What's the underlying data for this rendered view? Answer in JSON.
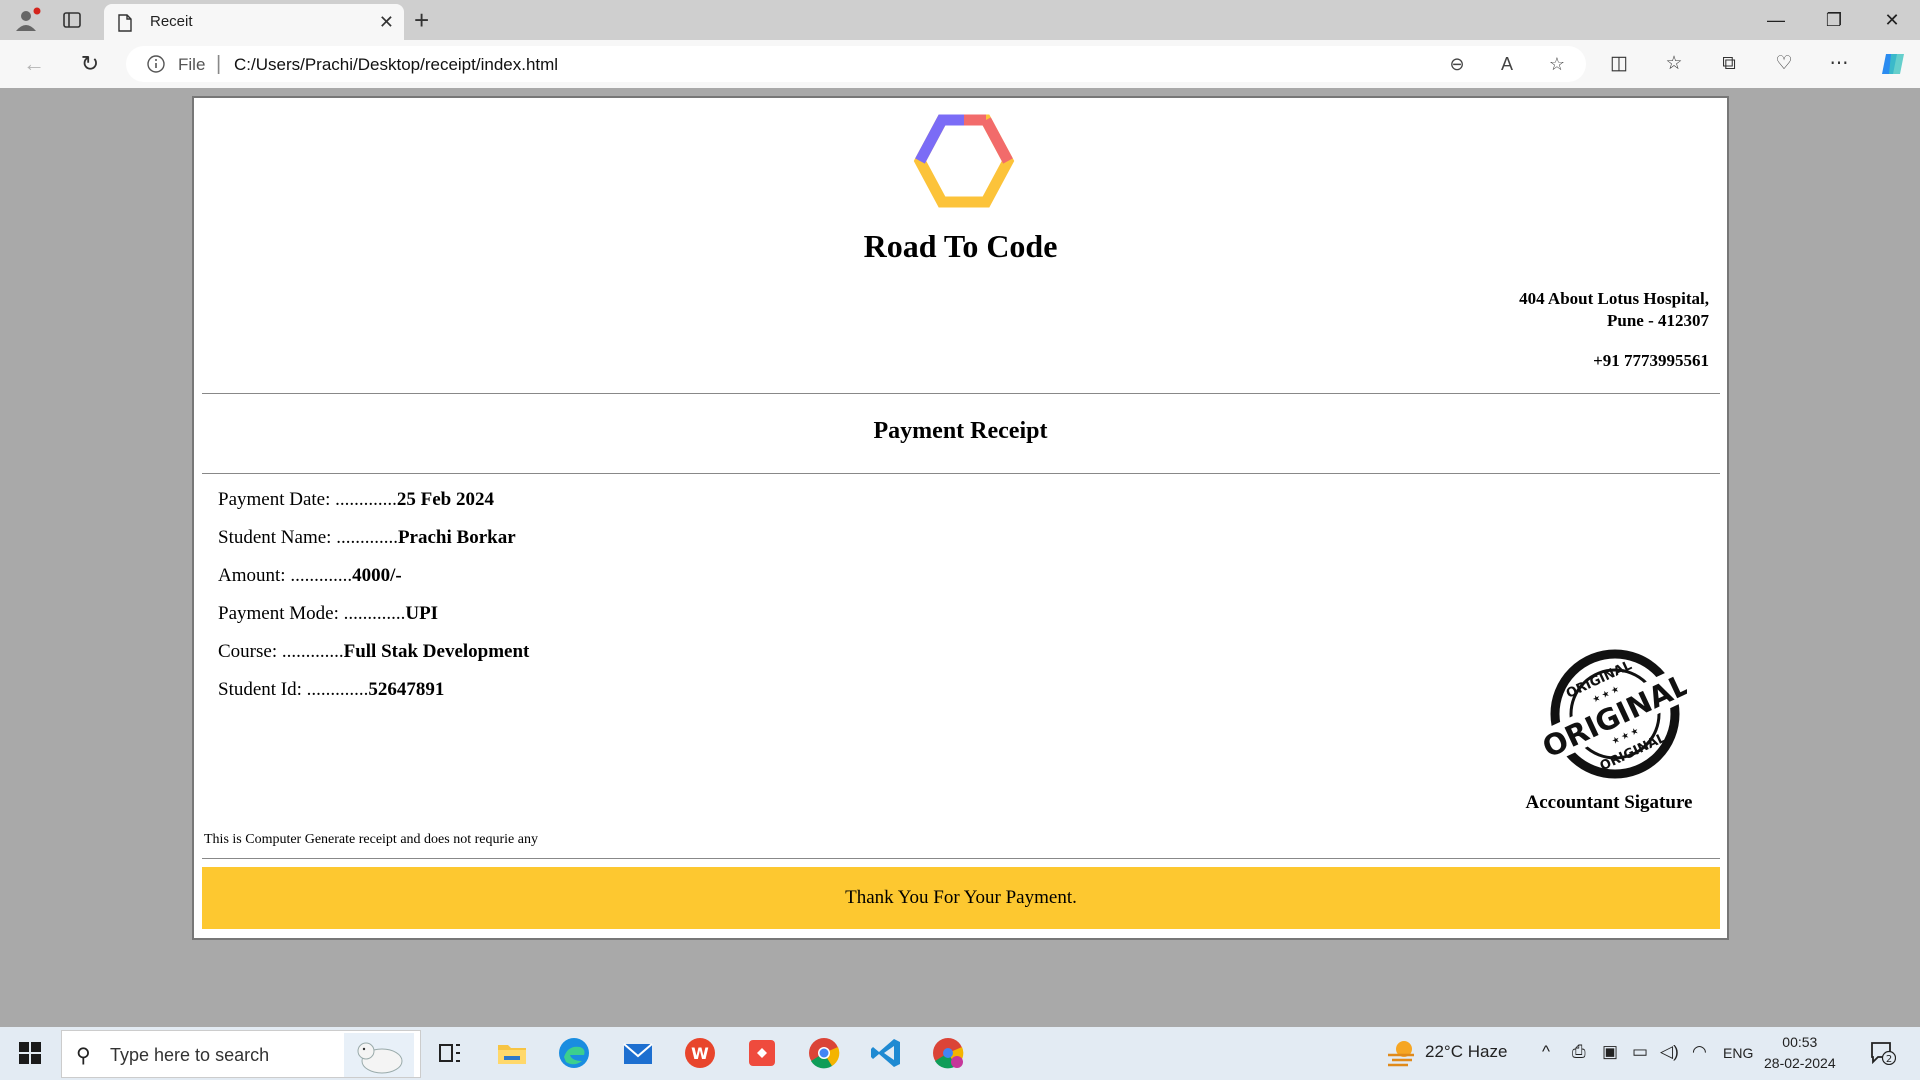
{
  "browser": {
    "tab_title": "Receit",
    "scheme_label": "File",
    "url": "C:/Users/Prachi/Desktop/receipt/index.html"
  },
  "receipt": {
    "brand": "Road To Code",
    "address_line1": "404 About Lotus Hospital,",
    "address_line2": "Pune - 412307",
    "phone": "+91 7773995561",
    "heading": "Payment Receipt",
    "fields": [
      {
        "label": "Payment Date: ",
        "dots": ".............",
        "value": "25 Feb 2024"
      },
      {
        "label": "Student Name: ",
        "dots": ".............",
        "value": "Prachi Borkar"
      },
      {
        "label": "Amount: ",
        "dots": ".............",
        "value": "4000/-"
      },
      {
        "label": "Payment Mode: ",
        "dots": ".............",
        "value": "UPI"
      },
      {
        "label": "Course: ",
        "dots": ".............",
        "value": "Full Stak Development"
      },
      {
        "label": "Student Id: ",
        "dots": ".............",
        "value": "52647891"
      }
    ],
    "stamp_text": "ORIGINAL",
    "signature_label": "Accountant Sigature",
    "note": "This is Computer Generate receipt and does not requrie any",
    "thanks": "Thank You For Your Payment.",
    "colors": {
      "accent": "#fdc830",
      "logo_purple": "#7b6cf6",
      "logo_red": "#f26b6b",
      "logo_yellow": "#fcc33a"
    }
  },
  "taskbar": {
    "search_placeholder": "Type here to search",
    "weather": "22°C  Haze",
    "language": "ENG",
    "time": "00:53",
    "date": "28-02-2024",
    "notification_count": "2"
  }
}
